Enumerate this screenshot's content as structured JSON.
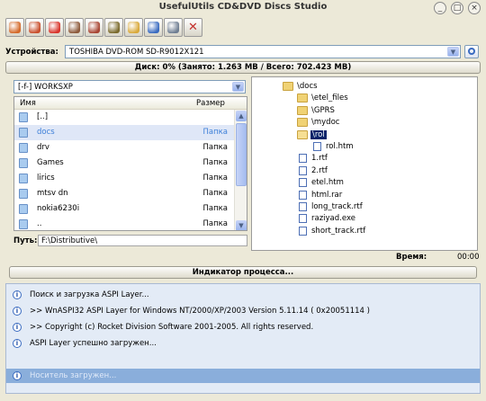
{
  "window": {
    "title": "UsefulUtils CD&DVD Discs Studio",
    "controls": [
      "_",
      "□",
      "×"
    ]
  },
  "toolbar": {
    "buttons": [
      {
        "name": "burn-disc-button",
        "color": "#d46a2a"
      },
      {
        "name": "erase-disc-button",
        "color": "#c94f2d"
      },
      {
        "name": "stop-button",
        "color": "#d8342b"
      },
      {
        "name": "copy-disc-button",
        "color": "#8d5a3b"
      },
      {
        "name": "image-button",
        "color": "#a84533"
      },
      {
        "name": "save-image-button",
        "color": "#7b6b2d"
      },
      {
        "name": "settings-button",
        "color": "#d9a93a"
      },
      {
        "name": "info-button",
        "color": "#3a6bc0"
      },
      {
        "name": "tools-button",
        "color": "#6f7e92"
      },
      {
        "name": "close-button",
        "color": "#c4302b",
        "glyph": "✕"
      }
    ]
  },
  "device": {
    "label": "Устройства:",
    "value": "TOSHIBA DVD-ROM SD-R9012X121"
  },
  "disk_info": "Диск: 0% (Занято: 1.263 MB / Всего: 702.423 MB)",
  "file_panel": {
    "drive": "[-f-] WORKSXP",
    "col_name": "Имя",
    "col_size": "Размер",
    "rows": [
      {
        "name": "[..]",
        "size": ""
      },
      {
        "name": "docs",
        "size": "Папка",
        "selected": true
      },
      {
        "name": "drv",
        "size": "Папка"
      },
      {
        "name": "Games",
        "size": "Папка"
      },
      {
        "name": "lirics",
        "size": "Папка"
      },
      {
        "name": "mtsv dn",
        "size": "Папка"
      },
      {
        "name": "nokia6230i",
        "size": "Папка"
      },
      {
        "name": "..",
        "size": "Папка"
      }
    ],
    "path_label": "Путь:",
    "path_value": "F:\\Distributive\\"
  },
  "tree": {
    "nodes": [
      {
        "label": "\\docs",
        "type": "folder",
        "level": 0
      },
      {
        "label": "\\etel_files",
        "type": "folder",
        "level": 1
      },
      {
        "label": "\\GPRS",
        "type": "folder",
        "level": 1
      },
      {
        "label": "\\mydoc",
        "type": "folder",
        "level": 1
      },
      {
        "label": "\\rol",
        "type": "folder-open",
        "level": 1,
        "selected": true
      },
      {
        "label": "rol.htm",
        "type": "file",
        "level": 2
      },
      {
        "label": "1.rtf",
        "type": "file",
        "level": 1
      },
      {
        "label": "2.rtf",
        "type": "file",
        "level": 1
      },
      {
        "label": "etel.htm",
        "type": "file",
        "level": 1
      },
      {
        "label": "html.rar",
        "type": "file",
        "level": 1
      },
      {
        "label": "long_track.rtf",
        "type": "file",
        "level": 1
      },
      {
        "label": "raziyad.exe",
        "type": "file",
        "level": 1
      },
      {
        "label": "short_track.rtf",
        "type": "file",
        "level": 1
      }
    ]
  },
  "time": {
    "label": "Время:",
    "value": "00:00"
  },
  "progress_label": "Индикатор процесса...",
  "log": {
    "lines": [
      "Поиск и загрузка ASPI Layer...",
      ">>   WnASPI32  ASPI Layer for Windows NT/2000/XP/2003  Version 5.11.14 ( 0x20051114 )",
      ">>   Copyright (c) Rocket Division Software 2001-2005. All rights reserved.",
      "ASPI Layer успешно загружен..."
    ],
    "status": "Носитель загружен..."
  }
}
